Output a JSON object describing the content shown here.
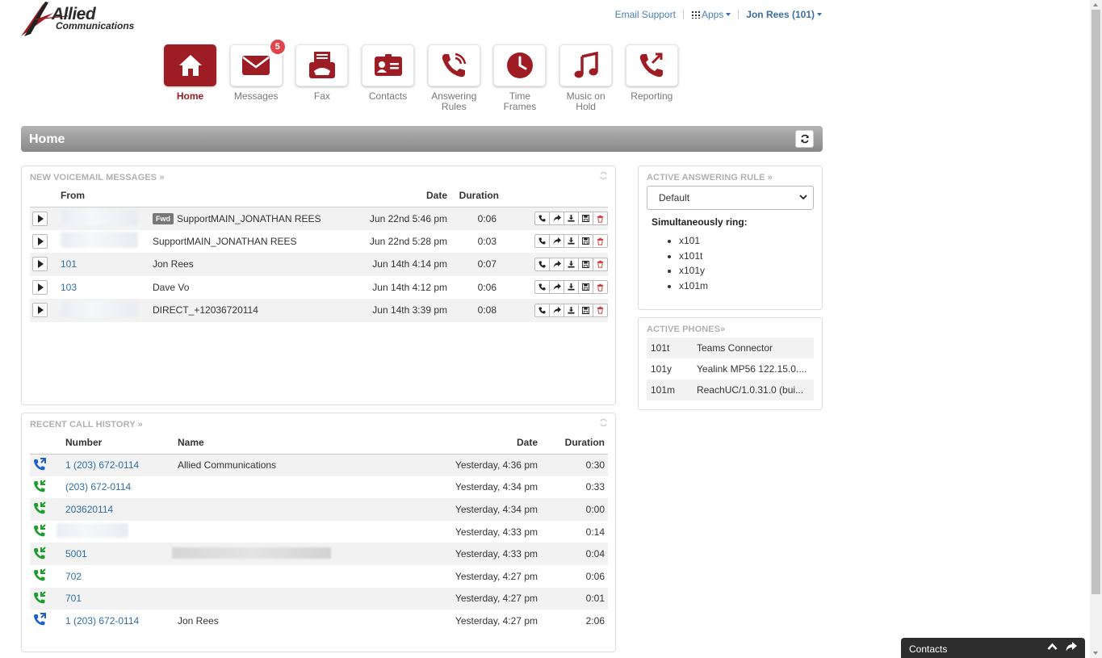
{
  "logo": {
    "line1": "Allied",
    "line2": "Communications"
  },
  "header": {
    "email_support": "Email Support",
    "apps": "Apps",
    "user": "Jon Rees (101)"
  },
  "nav": [
    {
      "label": "Home",
      "icon": "home-icon"
    },
    {
      "label": "Messages",
      "icon": "envelope-icon",
      "badge": "5"
    },
    {
      "label": "Fax",
      "icon": "fax-icon"
    },
    {
      "label": "Contacts",
      "icon": "contact-card-icon"
    },
    {
      "label": "Answering Rules",
      "icon": "phone-ringing-icon"
    },
    {
      "label": "Time Frames",
      "icon": "clock-icon"
    },
    {
      "label": "Music on Hold",
      "icon": "music-note-icon"
    },
    {
      "label": "Reporting",
      "icon": "phone-report-icon"
    }
  ],
  "page_title": "Home",
  "voicemail": {
    "title": "NEW VOICEMAIL MESSAGES »",
    "columns": {
      "from": "From",
      "date": "Date",
      "duration": "Duration"
    },
    "rows": [
      {
        "from_number": "",
        "fwd": "Fwd",
        "from_name": "SupportMAIN_JONATHAN REES",
        "date": "Jun 22nd 5:46 pm",
        "duration": "0:06"
      },
      {
        "from_number": "",
        "fwd": "",
        "from_name": "SupportMAIN_JONATHAN REES",
        "date": "Jun 22nd 5:28 pm",
        "duration": "0:03"
      },
      {
        "from_number": "101",
        "fwd": "",
        "from_name": "Jon Rees",
        "date": "Jun 14th 4:14 pm",
        "duration": "0:07"
      },
      {
        "from_number": "103",
        "fwd": "",
        "from_name": "Dave Vo",
        "date": "Jun 14th 4:12 pm",
        "duration": "0:06"
      },
      {
        "from_number": "",
        "fwd": "",
        "from_name": "DIRECT_+12036720114",
        "date": "Jun 14th 3:39 pm",
        "duration": "0:08"
      }
    ]
  },
  "call_history": {
    "title": "RECENT CALL HISTORY »",
    "columns": {
      "number": "Number",
      "name": "Name",
      "date": "Date",
      "duration": "Duration"
    },
    "rows": [
      {
        "direction": "outbound",
        "number": "1 (203) 672-0114",
        "name": "Allied Communications",
        "date": "Yesterday, 4:36 pm",
        "duration": "0:30"
      },
      {
        "direction": "inbound",
        "number": "(203) 672-0114",
        "name": "",
        "date": "Yesterday, 4:34 pm",
        "duration": "0:33"
      },
      {
        "direction": "inbound",
        "number": "203620114",
        "name": "",
        "date": "Yesterday, 4:34 pm",
        "duration": "0:00"
      },
      {
        "direction": "inbound",
        "number": "",
        "name": "",
        "date": "Yesterday, 4:33 pm",
        "duration": "0:14"
      },
      {
        "direction": "inbound",
        "number": "5001",
        "name": "",
        "date": "Yesterday, 4:33 pm",
        "duration": "0:04"
      },
      {
        "direction": "inbound",
        "number": "702",
        "name": "",
        "date": "Yesterday, 4:27 pm",
        "duration": "0:06"
      },
      {
        "direction": "inbound",
        "number": "701",
        "name": "",
        "date": "Yesterday, 4:27 pm",
        "duration": "0:01"
      },
      {
        "direction": "outbound",
        "number": "1 (203) 672-0114",
        "name": "Jon Rees",
        "date": "Yesterday, 4:27 pm",
        "duration": "2:06"
      }
    ]
  },
  "answering_rule": {
    "title": "ACTIVE ANSWERING RULE »",
    "selected": "Default",
    "sim_label": "Simultaneously ring:",
    "ring": [
      "x101",
      "x101t",
      "x101y",
      "x101m"
    ]
  },
  "phones": {
    "title": "ACTIVE PHONES»",
    "rows": [
      {
        "ext": "101t",
        "device": "Teams Connector"
      },
      {
        "ext": "101y",
        "device": "Yealink MP56 122.15.0...."
      },
      {
        "ext": "101m",
        "device": "ReachUC/1.0.31.0 (bui..."
      }
    ]
  },
  "dock": {
    "label": "Contacts"
  },
  "colors": {
    "brand": "#9e1c23",
    "link": "#2e6ea8",
    "inbound": "#1e9c2e",
    "outbound": "#1e5fc8",
    "badge": "#e0454c"
  }
}
